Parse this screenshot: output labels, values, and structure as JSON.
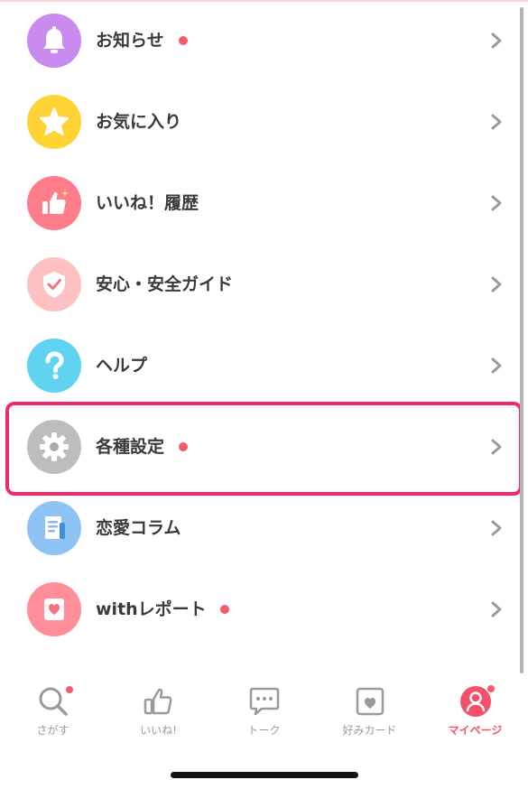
{
  "menu": {
    "items": [
      {
        "label": "お知らせ",
        "icon": "bell-icon",
        "color": "#c98bf0",
        "has_dot": true
      },
      {
        "label": "お気に入り",
        "icon": "star-icon",
        "color": "#ffd334",
        "has_dot": false
      },
      {
        "label": "いいね！履歴",
        "icon": "thumbs-up-icon",
        "color": "#ff7d8a",
        "has_dot": false
      },
      {
        "label": "安心・安全ガイド",
        "icon": "shield-check-icon",
        "color": "#ffc2c2",
        "has_dot": false
      },
      {
        "label": "ヘルプ",
        "icon": "question-icon",
        "color": "#5fd3f0",
        "has_dot": false
      },
      {
        "label": "各種設定",
        "icon": "gear-icon",
        "color": "#bdbdbd",
        "has_dot": true
      },
      {
        "label": "恋愛コラム",
        "icon": "document-icon",
        "color": "#8fc2f5",
        "has_dot": false
      },
      {
        "label": "withレポート",
        "icon": "heart-card-icon",
        "color": "#ff8e99",
        "has_dot": true
      }
    ]
  },
  "tabbar": {
    "tabs": [
      {
        "label": "さがす",
        "icon": "search-icon",
        "has_dot": true,
        "active": false
      },
      {
        "label": "いいね!",
        "icon": "thumbs-up-outline-icon",
        "has_dot": false,
        "active": false
      },
      {
        "label": "トーク",
        "icon": "chat-bubble-icon",
        "has_dot": false,
        "active": false
      },
      {
        "label": "好みカード",
        "icon": "heart-card-outline-icon",
        "has_dot": false,
        "active": false
      },
      {
        "label": "マイページ",
        "icon": "user-icon",
        "has_dot": true,
        "active": true
      }
    ]
  },
  "colors": {
    "highlight": "#ef2a6b",
    "badge_dot": "#f45a6b",
    "active_tab": "#f4506a",
    "inactive_tab": "#9a9a9a"
  }
}
